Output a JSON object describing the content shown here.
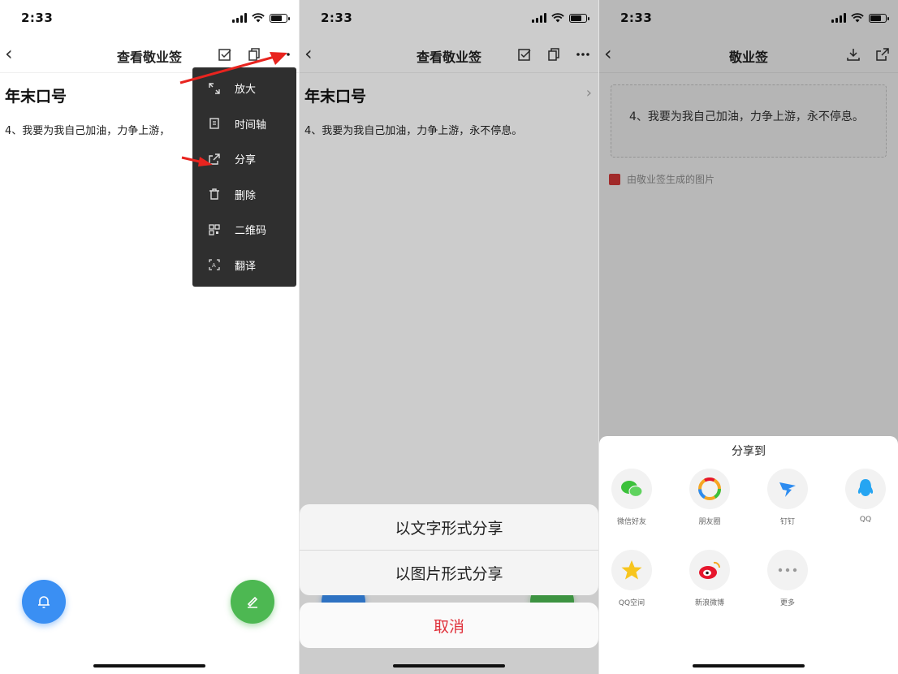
{
  "status": {
    "time": "2:33"
  },
  "panel1": {
    "nav_title": "查看敬业签",
    "note_title": "年末口号",
    "note_body": "4、我要为我自己加油，力争上游，",
    "menu": [
      {
        "label": "放大",
        "icon": "expand-icon"
      },
      {
        "label": "时间轴",
        "icon": "timeline-icon"
      },
      {
        "label": "分享",
        "icon": "share-icon"
      },
      {
        "label": "删除",
        "icon": "trash-icon"
      },
      {
        "label": "二维码",
        "icon": "qrcode-icon"
      },
      {
        "label": "翻译",
        "icon": "translate-icon"
      }
    ]
  },
  "panel2": {
    "nav_title": "查看敬业签",
    "note_title": "年末口号",
    "note_body": "4、我要为我自己加油，力争上游，永不停息。",
    "sheet": {
      "option_text": "以文字形式分享",
      "option_image": "以图片形式分享",
      "cancel": "取消"
    }
  },
  "panel3": {
    "nav_title": "敬业签",
    "card_text": "4、我要为我自己加油，力争上游，永不停息。",
    "credit": "由敬业签生成的图片",
    "share_title": "分享到",
    "share_targets": [
      {
        "label": "微信好友",
        "icon": "wechat-icon",
        "color": "#3cc13b"
      },
      {
        "label": "朋友圈",
        "icon": "moments-icon",
        "color": "#f5a623"
      },
      {
        "label": "钉钉",
        "icon": "dingtalk-icon",
        "color": "#2d8cf0"
      },
      {
        "label": "QQ",
        "icon": "qq-icon",
        "color": "#26a5f2"
      },
      {
        "label": "QQ空间",
        "icon": "qzone-icon",
        "color": "#f7c51e"
      },
      {
        "label": "新浪微博",
        "icon": "weibo-icon",
        "color": "#e6162d"
      },
      {
        "label": "更多",
        "icon": "more-icon",
        "color": "#999999"
      }
    ]
  },
  "colors": {
    "menu_bg": "#2f2f2f",
    "accent_red": "#e0333d",
    "fab_blue": "#3a8ff3",
    "fab_green": "#4db852"
  }
}
